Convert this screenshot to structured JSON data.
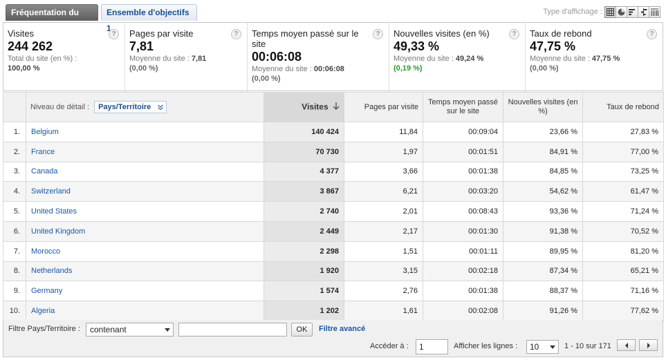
{
  "tabs": [
    {
      "label": "Fréquentation du site"
    },
    {
      "label": "Ensemble d'objectifs 1"
    }
  ],
  "view_type": {
    "label": "Type d'affichage :",
    "icons": [
      "table-view-icon",
      "pie-view-icon",
      "bar-view-icon",
      "comparison-view-icon",
      "pivot-view-icon"
    ]
  },
  "scorecards": [
    {
      "title": "Visites",
      "value": "244 262",
      "sub1": "Total du site (en %) :",
      "sub1_value": "",
      "sub2": "100,00 %"
    },
    {
      "title": "Pages par visite",
      "value": "7,81",
      "sub1": "Moyenne du site : ",
      "sub1_value": "7,81",
      "sub2": "(0,00 %)"
    },
    {
      "title": "Temps moyen passé sur le site",
      "value": "00:06:08",
      "sub1": "Moyenne du site : ",
      "sub1_value": "00:06:08",
      "sub2": "(0,00 %)"
    },
    {
      "title": "Nouvelles visites (en %)",
      "value": "49,33 %",
      "sub1": "Moyenne du site : ",
      "sub1_value": "49,24 %",
      "sub2": "(0,19 %)"
    },
    {
      "title": "Taux de rebond",
      "value": "47,75 %",
      "sub1": "Moyenne du site : ",
      "sub1_value": "47,75 %",
      "sub2": "(0,00 %)"
    }
  ],
  "help_glyph": "?",
  "table": {
    "dimension_label": "Niveau de détail :",
    "dimension_value": "Pays/Territoire",
    "headers": [
      "Visites",
      "Pages par visite",
      "Temps moyen passé sur le site",
      "Nouvelles visites (en %)",
      "Taux de rebond"
    ],
    "rows": [
      {
        "idx": "1.",
        "name": "Belgium",
        "visits": "140 424",
        "ppv": "11,84",
        "time": "00:09:04",
        "new": "23,66 %",
        "bounce": "27,83 %"
      },
      {
        "idx": "2.",
        "name": "France",
        "visits": "70 730",
        "ppv": "1,97",
        "time": "00:01:51",
        "new": "84,91 %",
        "bounce": "77,00 %"
      },
      {
        "idx": "3.",
        "name": "Canada",
        "visits": "4 377",
        "ppv": "3,66",
        "time": "00:01:38",
        "new": "84,85 %",
        "bounce": "73,25 %"
      },
      {
        "idx": "4.",
        "name": "Switzerland",
        "visits": "3 867",
        "ppv": "6,21",
        "time": "00:03:20",
        "new": "54,62 %",
        "bounce": "61,47 %"
      },
      {
        "idx": "5.",
        "name": "United States",
        "visits": "2 740",
        "ppv": "2,01",
        "time": "00:08:43",
        "new": "93,36 %",
        "bounce": "71,24 %"
      },
      {
        "idx": "6.",
        "name": "United Kingdom",
        "visits": "2 449",
        "ppv": "2,17",
        "time": "00:01:30",
        "new": "91,38 %",
        "bounce": "70,52 %"
      },
      {
        "idx": "7.",
        "name": "Morocco",
        "visits": "2 298",
        "ppv": "1,51",
        "time": "00:01:11",
        "new": "89,95 %",
        "bounce": "81,20 %"
      },
      {
        "idx": "8.",
        "name": "Netherlands",
        "visits": "1 920",
        "ppv": "3,15",
        "time": "00:02:18",
        "new": "87,34 %",
        "bounce": "65,21 %"
      },
      {
        "idx": "9.",
        "name": "Germany",
        "visits": "1 574",
        "ppv": "2,76",
        "time": "00:01:38",
        "new": "88,37 %",
        "bounce": "71,16 %"
      },
      {
        "idx": "10.",
        "name": "Algeria",
        "visits": "1 202",
        "ppv": "1,61",
        "time": "00:02:08",
        "new": "91,26 %",
        "bounce": "77,62 %"
      }
    ]
  },
  "footer": {
    "filter_label": "Filtre Pays/Territoire :",
    "filter_mode": "contenant",
    "filter_text": "",
    "ok_label": "OK",
    "advanced_label": "Filtre avancé",
    "goto_label": "Accéder à :",
    "goto_value": "1",
    "rows_label": "Afficher les lignes :",
    "rows_value": "10",
    "range": "1 - 10 sur 171"
  },
  "colors": {
    "link": "#1a57a5",
    "positive": "#2a9a2a"
  }
}
